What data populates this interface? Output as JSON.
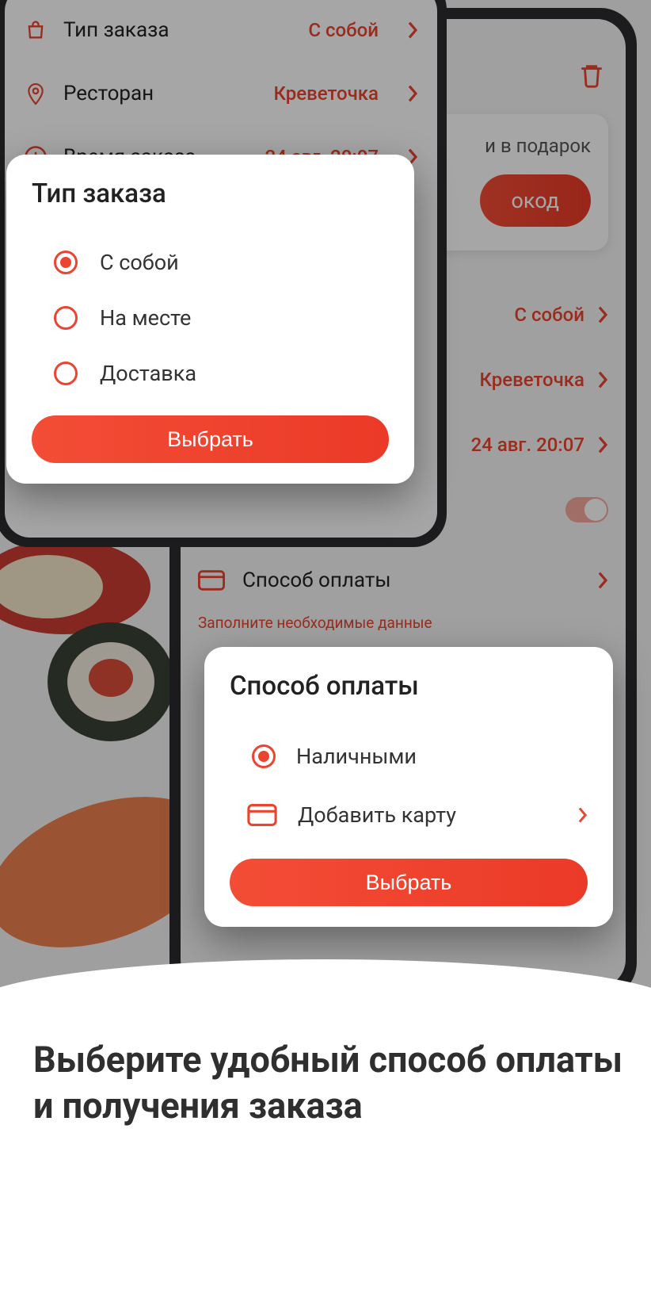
{
  "colors": {
    "accent": "#eb4430",
    "bg": "#f5f5f5"
  },
  "phoneA": {
    "rows": [
      {
        "icon": "bag",
        "label": "Тип заказа",
        "value": "С собой"
      },
      {
        "icon": "pin",
        "label": "Ресторан",
        "value": "Креветочка"
      },
      {
        "icon": "clock",
        "label": "Время заказа",
        "value": "24 авг. 20:07"
      }
    ]
  },
  "modalA": {
    "title": "Тип заказа",
    "options": [
      {
        "label": "С собой",
        "selected": true
      },
      {
        "label": "На месте",
        "selected": false
      },
      {
        "label": "Доставка",
        "selected": false
      }
    ],
    "cta": "Выбрать"
  },
  "phoneB": {
    "gift_text": "и в подарок",
    "promo_btn": "окод",
    "rows": [
      {
        "value": "С собой"
      },
      {
        "value": "Креветочка"
      },
      {
        "value": "24 авг. 20:07"
      }
    ],
    "payment_label": "Способ оплаты",
    "hint": "Заполните необходимые данные"
  },
  "modalB": {
    "title": "Способ оплаты",
    "options": [
      {
        "type": "radio",
        "label": "Наличными",
        "selected": true
      },
      {
        "type": "card",
        "label": "Добавить карту"
      }
    ],
    "cta": "Выбрать"
  },
  "headline": "Выберите удобный способ оплаты и получения заказа"
}
